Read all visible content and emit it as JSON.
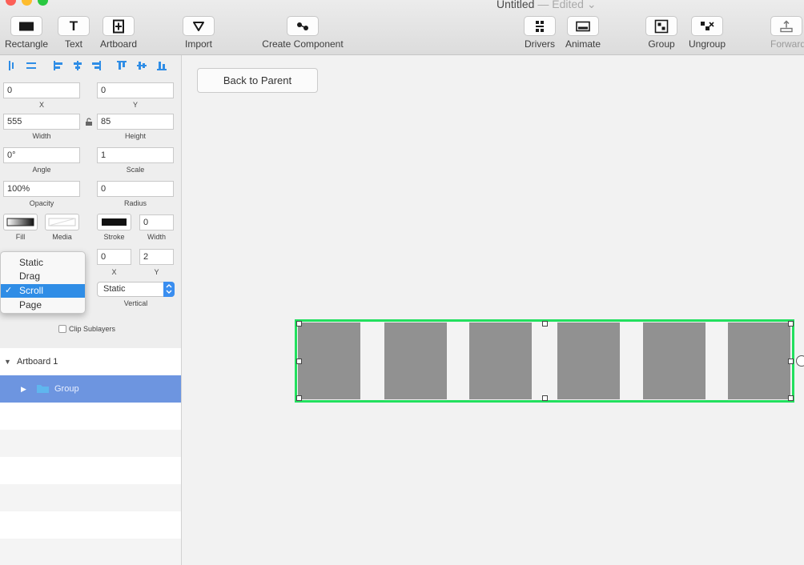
{
  "window": {
    "title": "Untitled",
    "edited": "— Edited ⌄"
  },
  "toolbar": {
    "rectangle": "Rectangle",
    "text": "Text",
    "artboard": "Artboard",
    "import": "Import",
    "create_component": "Create Component",
    "drivers": "Drivers",
    "animate": "Animate",
    "group": "Group",
    "ungroup": "Ungroup",
    "forward": "Forward",
    "text_glyph": "T"
  },
  "inspector": {
    "x": {
      "value": "0",
      "label": "X"
    },
    "y": {
      "value": "0",
      "label": "Y"
    },
    "width": {
      "value": "555",
      "label": "Width"
    },
    "height": {
      "value": "85",
      "label": "Height"
    },
    "angle": {
      "value": "0°",
      "label": "Angle"
    },
    "scale": {
      "value": "1",
      "label": "Scale"
    },
    "opacity": {
      "value": "100%",
      "label": "Opacity"
    },
    "radius": {
      "value": "0",
      "label": "Radius"
    },
    "fill_label": "Fill",
    "media_label": "Media",
    "stroke_label": "Stroke",
    "stroke_width": {
      "value": "0",
      "label": "Width"
    },
    "shadow_x": {
      "value": "0",
      "label": "X"
    },
    "shadow_y": {
      "value": "2",
      "label": "Y"
    },
    "vertical_select": "Static",
    "vertical_label": "Vertical",
    "clip_sublayers": "Clip Sublayers"
  },
  "behavior_menu": {
    "items": [
      "Static",
      "Drag",
      "Scroll",
      "Page"
    ],
    "selected": "Scroll",
    "check": "✓"
  },
  "layers": {
    "artboard": "Artboard 1",
    "group": "Group"
  },
  "canvas": {
    "back_button": "Back to Parent"
  },
  "colors": {
    "selection_border": "#22e05e",
    "cell_fill": "#919191",
    "selected_menu": "#2f8de6",
    "selected_layer": "#6d95e0"
  }
}
